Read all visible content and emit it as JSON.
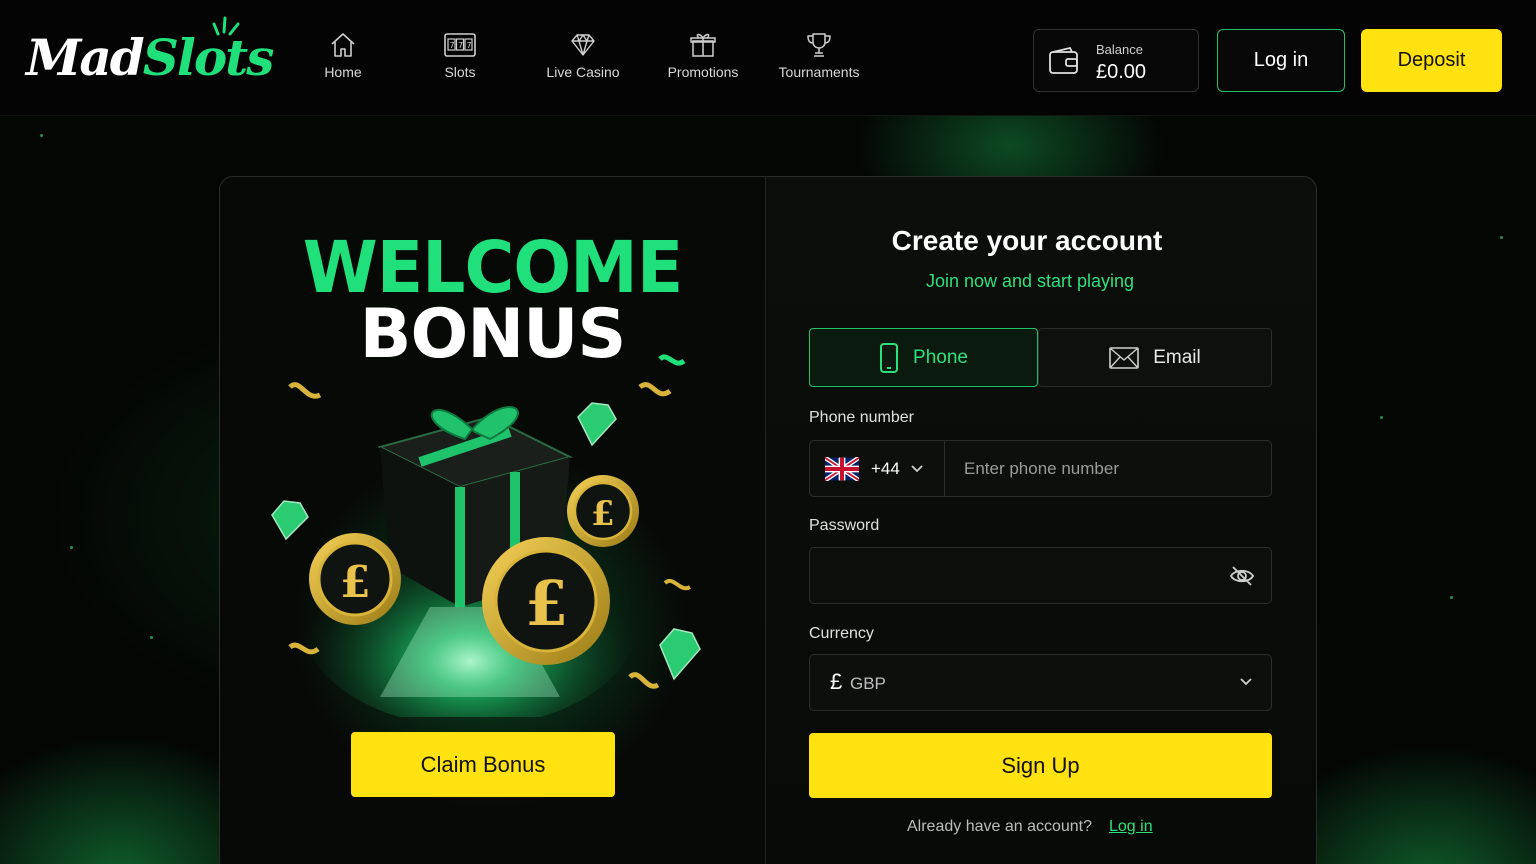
{
  "brand": {
    "logo_part1": "Mad",
    "logo_part2": "Slots"
  },
  "nav": [
    {
      "label": "Home",
      "icon": "home-icon"
    },
    {
      "label": "Slots",
      "icon": "slot-machine-icon"
    },
    {
      "label": "Live Casino",
      "icon": "diamond-icon"
    },
    {
      "label": "Promotions",
      "icon": "gift-icon"
    },
    {
      "label": "Tournaments",
      "icon": "trophy-icon"
    }
  ],
  "header": {
    "balance_label": "Balance",
    "balance_value": "£0.00",
    "login_label": "Log in",
    "deposit_label": "Deposit"
  },
  "promo": {
    "title_line1": "WELCOME",
    "title_line2": "BONUS",
    "claim_label": "Claim Bonus"
  },
  "form": {
    "title": "Create your account",
    "subtitle": "Join now and start playing",
    "tabs": [
      {
        "label": "Phone",
        "icon": "mobile-phone-icon",
        "active": true
      },
      {
        "label": "Email",
        "icon": "envelope-icon",
        "active": false
      }
    ],
    "phone_label": "Phone number",
    "country_code": "+44",
    "country_flag": "uk-flag-icon",
    "phone_placeholder": "Enter phone number",
    "password_label": "Password",
    "currency_label": "Currency",
    "currency_symbol": "£",
    "currency_value": "GBP",
    "signup_label": "Sign Up",
    "already_text": "Already have an account?",
    "login_link": "Log in"
  },
  "colors": {
    "accent_green": "#1fe07a",
    "accent_yellow": "#ffe20f",
    "background": "#050705"
  }
}
